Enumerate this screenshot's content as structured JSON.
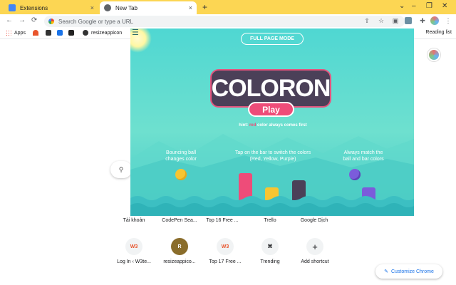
{
  "tabs": [
    {
      "title": "Extensions",
      "icon": "puzzle-icon",
      "close": "×"
    },
    {
      "title": "New Tab",
      "icon": "chrome-icon",
      "close": "×"
    }
  ],
  "new_tab_symbol": "+",
  "window_controls": {
    "dropdown": "⌄",
    "minimize": "–",
    "restore": "❐",
    "close": "✕"
  },
  "nav": {
    "back": "←",
    "forward": "→",
    "reload": "⟳"
  },
  "omnibox": {
    "placeholder": "Search Google or type a URL"
  },
  "bookmarks": [
    {
      "label": "Apps",
      "icon": "apps-grid-icon"
    },
    {
      "label": "",
      "icon": "flame-icon"
    },
    {
      "label": "",
      "icon": "puzzle-icon"
    },
    {
      "label": "",
      "icon": "bookmark-icon"
    },
    {
      "label": "",
      "icon": "trello-icon"
    },
    {
      "label": "resizeappicon",
      "icon": "globe-icon"
    }
  ],
  "reading_list": "Reading list",
  "game": {
    "full_page_mode": "FULL PAGE MODE",
    "logo": "COLORON",
    "play": "Play",
    "hint_prefix": "hint: ",
    "hint_highlight": "red",
    "hint_suffix": " color always comes first",
    "tip1": "Bouncing ball\nchanges color",
    "tip2": "Tap on the bar to switch the colors\n(Red, Yellow, Purple)",
    "tip3": "Always match the\nball and bar colors",
    "colors": {
      "sky": "#4fd7d2",
      "logo_bg": "#4b4058",
      "accent": "#ee4c79",
      "yellow": "#f7c531",
      "purple": "#7b5cdb",
      "bar_dark": "#4b4058"
    }
  },
  "shortcuts_row1": [
    {
      "label": "Tài khoản"
    },
    {
      "label": "CodePen Sea..."
    },
    {
      "label": "Top 16 Free ..."
    },
    {
      "label": "Trello"
    },
    {
      "label": "Google Dịch"
    }
  ],
  "shortcuts_row2": [
    {
      "label": "Log In ‹ W3te...",
      "badge": "W3",
      "color": "#e8552d"
    },
    {
      "label": "resizeappico...",
      "badge": "R",
      "color": "#8a6d2b"
    },
    {
      "label": "Top 17 Free ...",
      "badge": "W3",
      "color": "#e8552d"
    },
    {
      "label": "Trending",
      "badge": "⌘",
      "color": "#333333"
    },
    {
      "label": "Add shortcut",
      "badge": "+",
      "color": "#333333"
    }
  ],
  "customize": "Customize Chrome",
  "search_icon": "🔍"
}
